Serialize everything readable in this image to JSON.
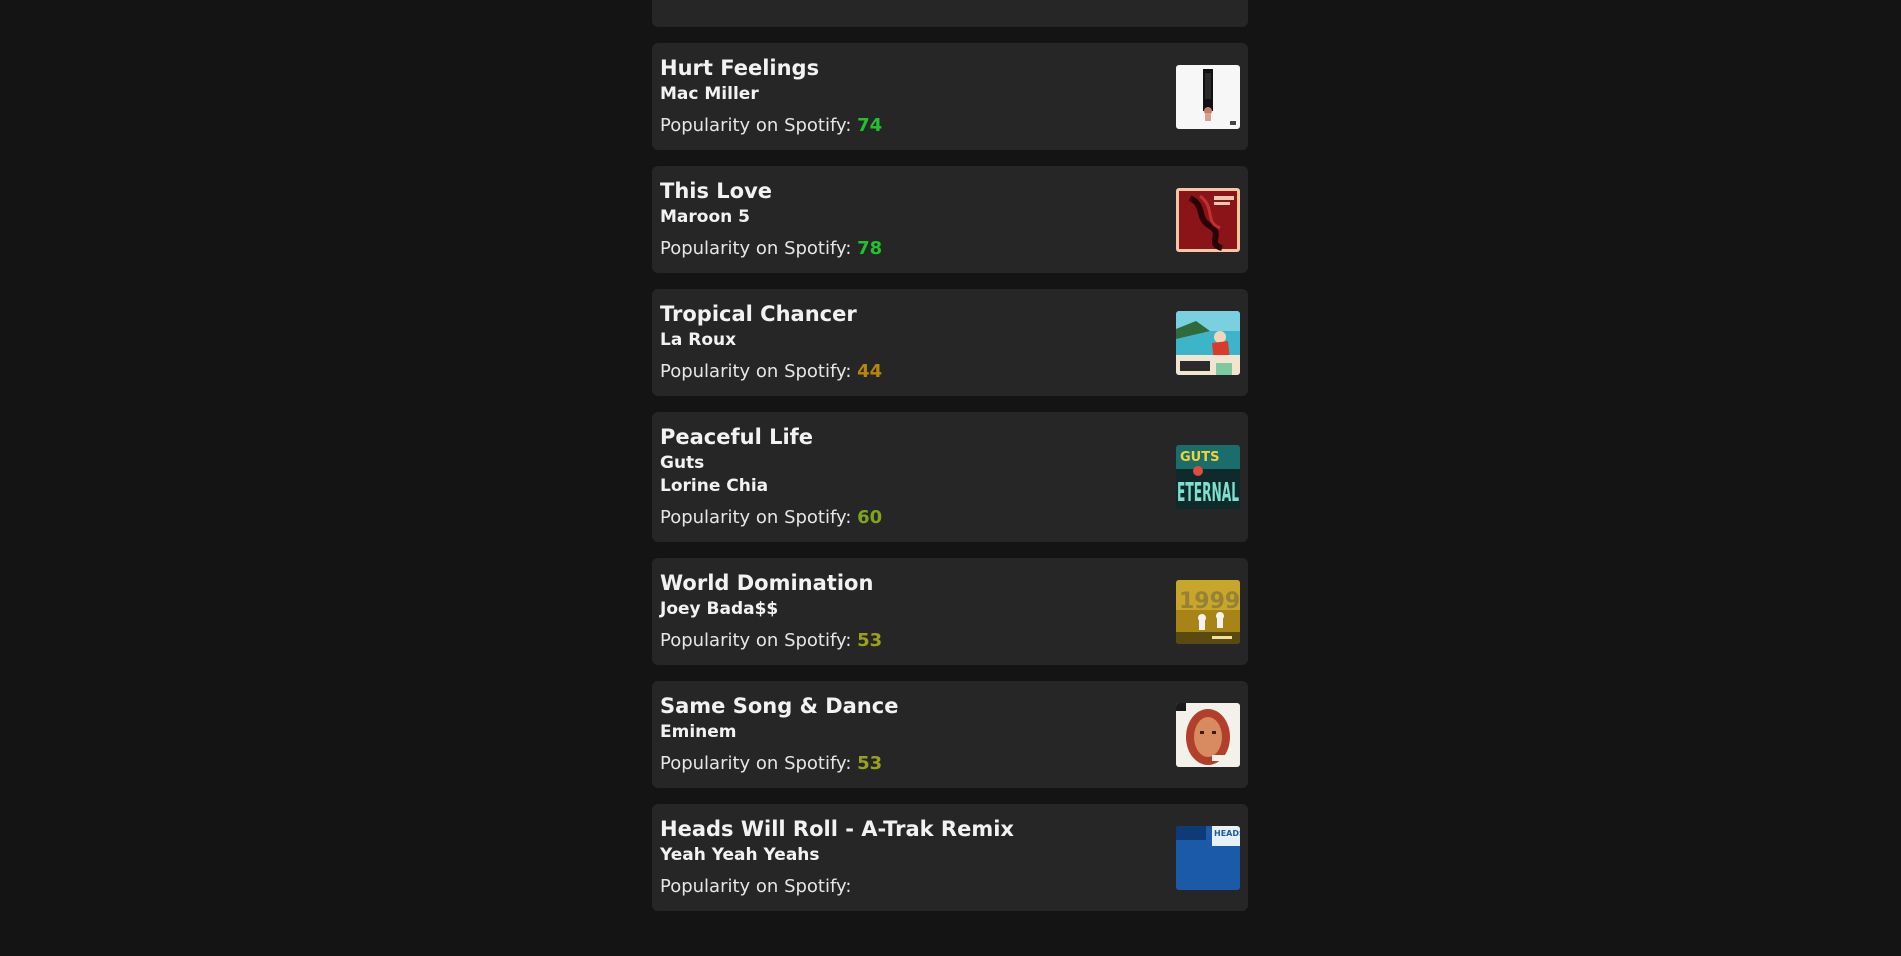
{
  "popularity_label": "Popularity on Spotify:",
  "tracks": [
    {
      "title": "Hurt Feelings",
      "artists": [
        "Mac Miller"
      ],
      "popularity": "74",
      "popularity_color": "#22c12e",
      "cover_icon": "swimming-album-cover-icon"
    },
    {
      "title": "This Love",
      "artists": [
        "Maroon 5"
      ],
      "popularity": "78",
      "popularity_color": "#22c12e",
      "cover_icon": "songs-about-jane-album-cover-icon"
    },
    {
      "title": "Tropical Chancer",
      "artists": [
        "La Roux"
      ],
      "popularity": "44",
      "popularity_color": "#b8860b",
      "cover_icon": "trouble-in-paradise-album-cover-icon"
    },
    {
      "title": "Peaceful Life",
      "artists": [
        "Guts",
        "Lorine Chia"
      ],
      "popularity": "60",
      "popularity_color": "#7fa51c",
      "cover_icon": "eternal-album-cover-icon"
    },
    {
      "title": "World Domination",
      "artists": [
        "Joey Bada$$"
      ],
      "popularity": "53",
      "popularity_color": "#9aa21a",
      "cover_icon": "1999-album-cover-icon"
    },
    {
      "title": "Same Song & Dance",
      "artists": [
        "Eminem"
      ],
      "popularity": "53",
      "popularity_color": "#9aa21a",
      "cover_icon": "relapse-album-cover-icon"
    },
    {
      "title": "Heads Will Roll - A-Trak Remix",
      "artists": [
        "Yeah Yeah Yeahs"
      ],
      "popularity": "",
      "popularity_color": "#22c12e",
      "cover_icon": "heads-will-roll-album-cover-icon"
    }
  ]
}
